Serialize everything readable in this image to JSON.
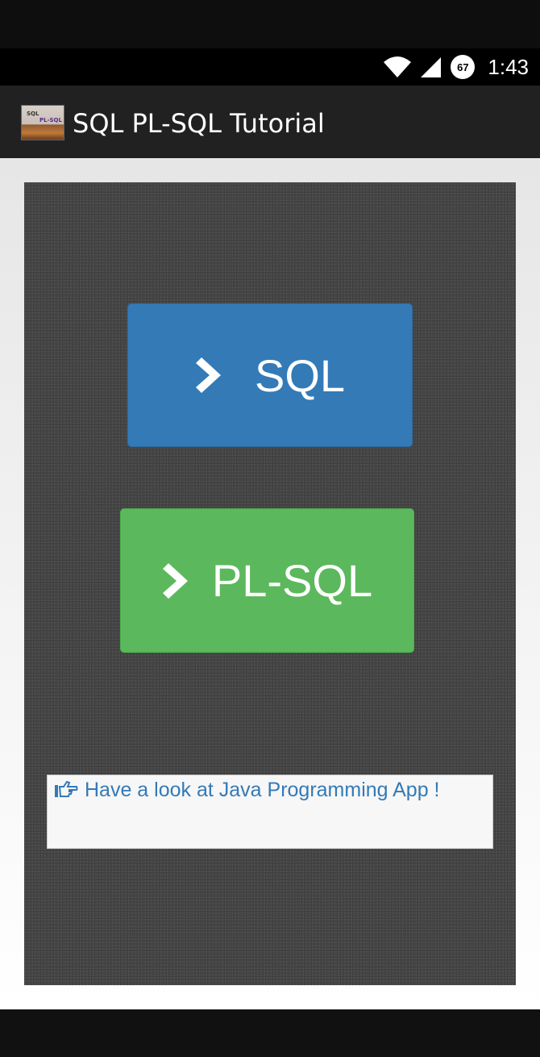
{
  "status_bar": {
    "time": "1:43",
    "battery": "67"
  },
  "app_bar": {
    "title": "SQL PL-SQL Tutorial",
    "icon_text_1": "SQL",
    "icon_text_2": "PL-SQL"
  },
  "buttons": {
    "sql_label": "SQL",
    "plsql_label": "PL-SQL"
  },
  "promo": {
    "text": "Have a look at Java Programming App !"
  },
  "colors": {
    "sql_button": "#337ab7",
    "plsql_button": "#5cb85c",
    "link": "#337ab7",
    "app_bar": "#212121",
    "panel": "#464646"
  }
}
